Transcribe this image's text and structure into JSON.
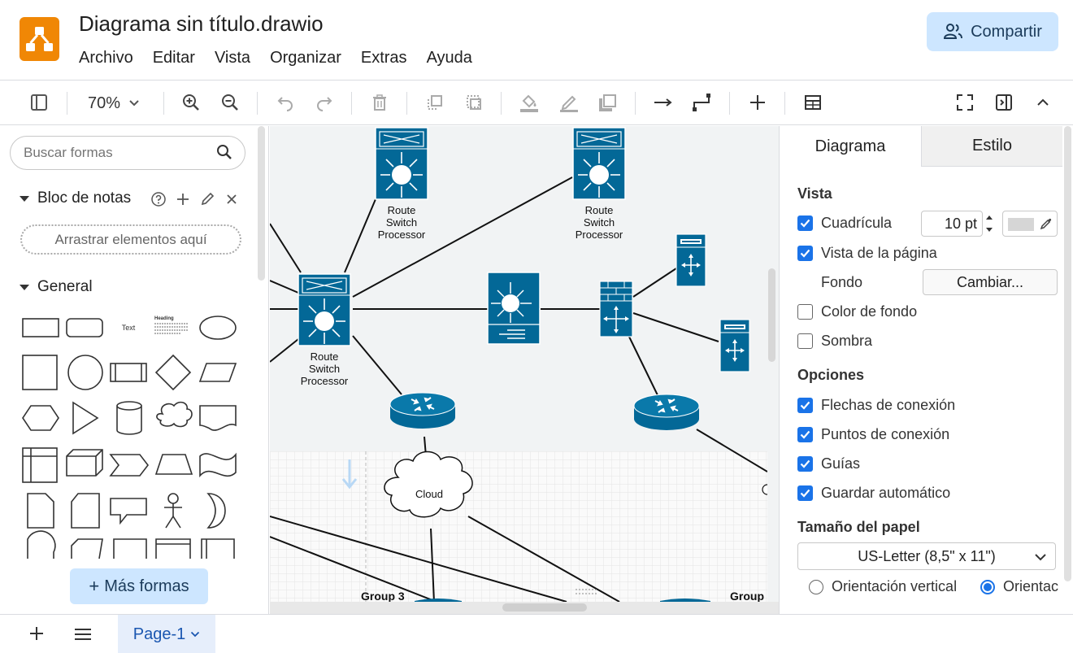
{
  "header": {
    "title": "Diagrama sin título.drawio",
    "menus": [
      "Archivo",
      "Editar",
      "Vista",
      "Organizar",
      "Extras",
      "Ayuda"
    ],
    "share_label": "Compartir"
  },
  "toolbar": {
    "zoom": "70%"
  },
  "left_panel": {
    "search_placeholder": "Buscar formas",
    "notes_title": "Bloc de notas",
    "drop_hint": "Arrastrar elementos aquí",
    "general_title": "General",
    "shape_text_label": "Text",
    "shape_heading_label": "Heading",
    "more_shapes_label": "Más formas"
  },
  "canvas": {
    "labels": {
      "rsp1": [
        "Route",
        "Switch",
        "Processor"
      ],
      "rsp2": [
        "Route",
        "Switch",
        "Processor"
      ],
      "rsp3": [
        "Route",
        "Switch",
        "Processor"
      ],
      "cloud": "Cloud",
      "group3": "Group 3",
      "group_right": "Group"
    },
    "colors": {
      "device": "#036897",
      "device_dark": "#024d70"
    }
  },
  "right_panel": {
    "tabs": [
      "Diagrama",
      "Estilo"
    ],
    "view_title": "Vista",
    "grid_label": "Cuadrícula",
    "grid_size": "10 pt",
    "page_view_label": "Vista de la página",
    "background_label": "Fondo",
    "change_label": "Cambiar...",
    "bg_color_label": "Color de fondo",
    "shadow_label": "Sombra",
    "options_title": "Opciones",
    "options": [
      "Flechas de conexión",
      "Puntos de conexión",
      "Guías",
      "Guardar automático"
    ],
    "paper_title": "Tamaño del papel",
    "paper_size": "US-Letter (8,5\" x 11\")",
    "orientation_portrait": "Orientación vertical",
    "orientation_landscape": "Orientac"
  },
  "footer": {
    "page_tab": "Page-1"
  }
}
